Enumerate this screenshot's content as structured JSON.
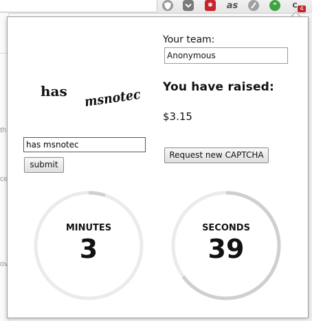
{
  "toolbar": {
    "extensions": [
      "shield-extension-icon",
      "pocket-extension-icon",
      "lastpass-extension-icon",
      "lastfm-extension-icon",
      "feedly-extension-icon",
      "hangouts-extension-icon",
      "captcha-extension-icon"
    ],
    "lastfm_label": "as",
    "badge_count": "4"
  },
  "background_fragments": [
    "th",
    "ce",
    "ov"
  ],
  "captcha": {
    "word1": "has",
    "word2": "msnotec",
    "input_value": "has msnotec",
    "submit_label": "submit",
    "request_new_label": "Request new CAPTCHA"
  },
  "team": {
    "label": "Your team:",
    "value": "Anonymous"
  },
  "raised": {
    "title": "You have raised:",
    "amount": "$3.15"
  },
  "timers": {
    "minutes": {
      "label": "MINUTES",
      "value": "3",
      "fraction": 0.05
    },
    "seconds": {
      "label": "SECONDS",
      "value": "39",
      "fraction": 0.65
    },
    "track_color": "#ebebeb",
    "progress_color": "#cfcfcf"
  }
}
